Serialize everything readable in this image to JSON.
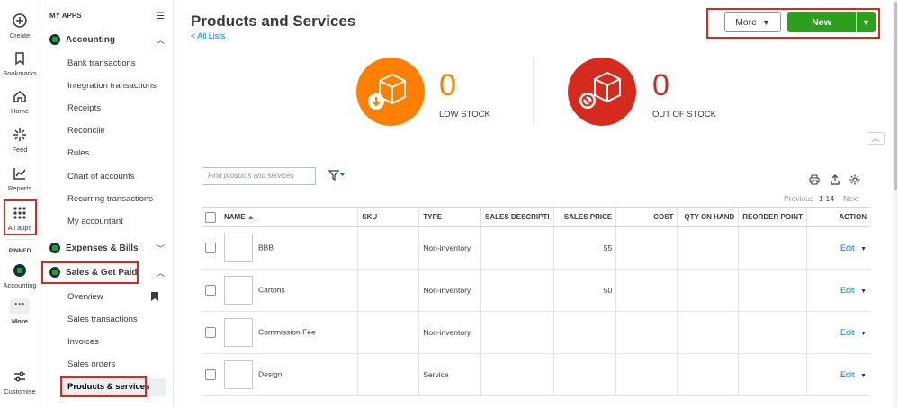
{
  "rail": {
    "items": [
      {
        "label": "Create",
        "icon": "plus-circle-icon"
      },
      {
        "label": "Bookmarks",
        "icon": "bookmark-icon"
      },
      {
        "label": "Home",
        "icon": "home-icon"
      },
      {
        "label": "Feed",
        "icon": "sparkle-icon"
      },
      {
        "label": "Reports",
        "icon": "line-chart-icon"
      },
      {
        "label": "All apps",
        "icon": "grid-icon"
      }
    ],
    "pinned_label": "PINNED",
    "pinned_app": "Accounting",
    "more_label": "More",
    "customise_label": "Customise"
  },
  "nav": {
    "header": "MY APPS",
    "groups": [
      {
        "label": "Accounting"
      },
      {
        "label": "Expenses & Bills"
      },
      {
        "label": "Sales & Get Paid"
      }
    ],
    "accounting_items": [
      "Bank transactions",
      "Integration transactions",
      "Receipts",
      "Reconcile",
      "Rules",
      "Chart of accounts",
      "Recurring transactions",
      "My accountant"
    ],
    "sales_items": [
      "Overview",
      "Sales transactions",
      "Invoices",
      "Sales orders",
      "Products & services"
    ]
  },
  "page": {
    "title": "Products and Services",
    "back_link": "< All Lists",
    "more_button": "More",
    "new_button": "New"
  },
  "stats": {
    "low_stock_value": "0",
    "low_stock_label": "LOW STOCK",
    "out_of_stock_value": "0",
    "out_of_stock_label": "OUT OF STOCK"
  },
  "toolbar": {
    "search_placeholder": "Find products and services",
    "pager_previous": "Previous",
    "pager_range": "1-14",
    "pager_next": "Next"
  },
  "table": {
    "columns": [
      "NAME",
      "SKU",
      "TYPE",
      "SALES DESCRIPTI",
      "SALES PRICE",
      "COST",
      "QTY ON HAND",
      "REORDER POINT",
      "ACTION"
    ],
    "rows": [
      {
        "name": "BBB",
        "sku": "",
        "type": "Non-inventory",
        "desc": "",
        "price": "55",
        "action": "Edit"
      },
      {
        "name": "Cartons",
        "sku": "",
        "type": "Non-inventory",
        "desc": "",
        "price": "50",
        "action": "Edit"
      },
      {
        "name": "Commission Fee",
        "sku": "",
        "type": "Non-inventory",
        "desc": "",
        "price": "",
        "action": "Edit"
      },
      {
        "name": "Design",
        "sku": "",
        "type": "Service",
        "desc": "",
        "price": "",
        "action": "Edit"
      }
    ]
  },
  "colors": {
    "brand_green": "#2ca01c",
    "low_stock_orange": "#ff8000",
    "out_of_stock_red": "#d52b1e",
    "link_blue": "#0077c5",
    "highlight_red": "#d52b1e"
  }
}
